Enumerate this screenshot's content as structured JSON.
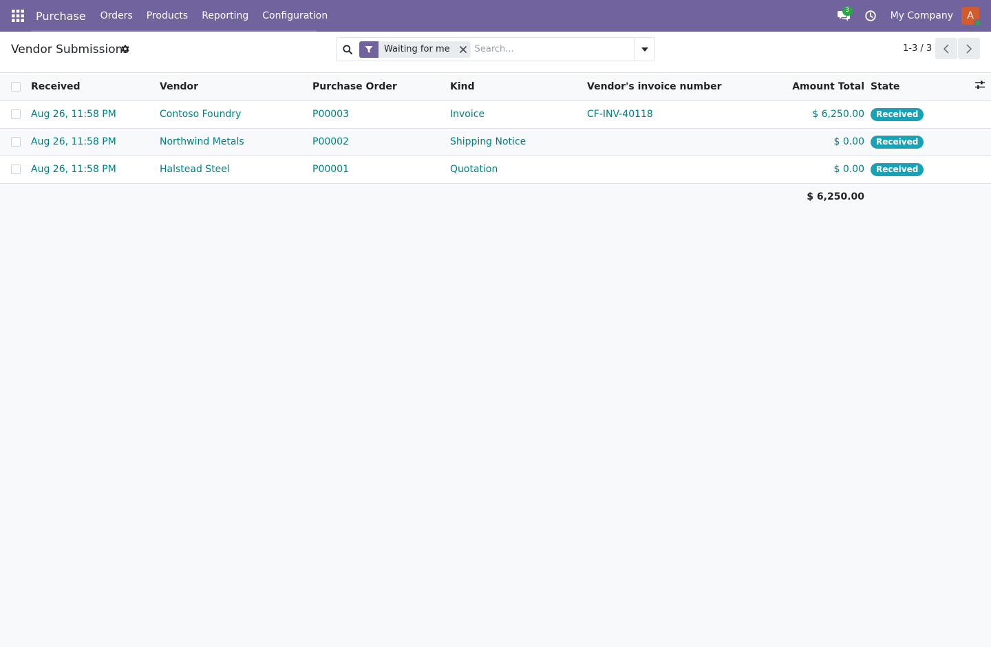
{
  "navbar": {
    "app_name": "Purchase",
    "menu": [
      "Orders",
      "Products",
      "Reporting",
      "Configuration"
    ],
    "messages_count": "3",
    "company": "My Company",
    "avatar_initial": "A",
    "color": "#71639e"
  },
  "control": {
    "title": "Vendor Submissions",
    "search": {
      "facet_label": "Waiting for me",
      "placeholder": "Search..."
    },
    "pager": "1-3 / 3"
  },
  "table": {
    "headers": {
      "received": "Received",
      "vendor": "Vendor",
      "purchase_order": "Purchase Order",
      "kind": "Kind",
      "invoice_number": "Vendor's invoice number",
      "amount_total": "Amount Total",
      "state": "State"
    },
    "rows": [
      {
        "received": "Aug 26, 11:58 PM",
        "vendor": "Contoso Foundry",
        "purchase_order": "P00003",
        "kind": "Invoice",
        "invoice_number": "CF-INV-40118",
        "amount_total": "$ 6,250.00",
        "state": "Received"
      },
      {
        "received": "Aug 26, 11:58 PM",
        "vendor": "Northwind Metals",
        "purchase_order": "P00002",
        "kind": "Shipping Notice",
        "invoice_number": "",
        "amount_total": "$ 0.00",
        "state": "Received"
      },
      {
        "received": "Aug 26, 11:58 PM",
        "vendor": "Halstead Steel",
        "purchase_order": "P00001",
        "kind": "Quotation",
        "invoice_number": "",
        "amount_total": "$ 0.00",
        "state": "Received"
      }
    ],
    "footer_total": "$ 6,250.00",
    "state_color": "#17a2b8",
    "link_color": "#017e84"
  }
}
